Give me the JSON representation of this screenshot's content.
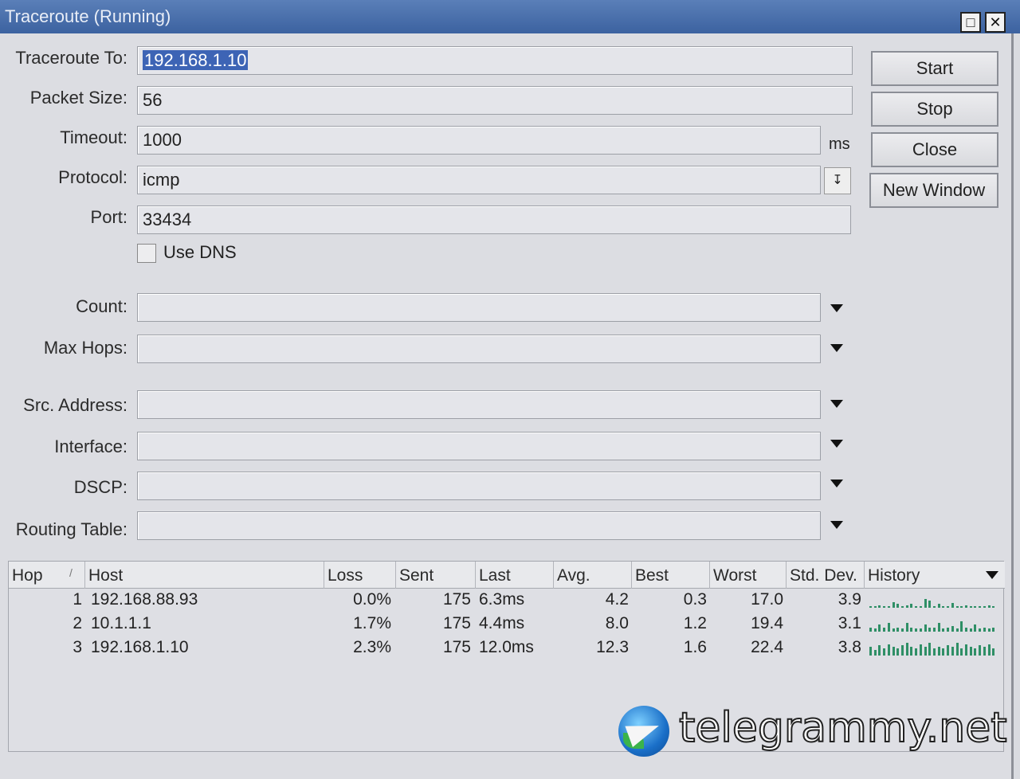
{
  "window": {
    "title": "Traceroute (Running)",
    "maximize_icon": "□",
    "close_icon": "✕"
  },
  "form": {
    "traceroute_to_label": "Traceroute To:",
    "traceroute_to_value": "192.168.1.10",
    "packet_size_label": "Packet Size:",
    "packet_size_value": "56",
    "timeout_label": "Timeout:",
    "timeout_value": "1000",
    "timeout_unit": "ms",
    "protocol_label": "Protocol:",
    "protocol_value": "icmp",
    "port_label": "Port:",
    "port_value": "33434",
    "use_dns_label": "Use DNS",
    "use_dns_checked": false,
    "count_label": "Count:",
    "max_hops_label": "Max Hops:",
    "src_address_label": "Src. Address:",
    "interface_label": "Interface:",
    "dscp_label": "DSCP:",
    "routing_table_label": "Routing Table:"
  },
  "buttons": {
    "start": "Start",
    "stop": "Stop",
    "close": "Close",
    "new_window": "New Window"
  },
  "table": {
    "headers": [
      "Hop",
      "Host",
      "Loss",
      "Sent",
      "Last",
      "Avg.",
      "Best",
      "Worst",
      "Std. Dev.",
      "History"
    ],
    "sort_indicator": "/",
    "rows": [
      {
        "hop": "1",
        "host": "192.168.88.93",
        "loss": "0.0%",
        "sent": "175",
        "last": "6.3ms",
        "avg": "4.2",
        "best": "0.3",
        "worst": "17.0",
        "std_dev": "3.9",
        "history": [
          0.1,
          0.1,
          0.15,
          0.1,
          0.1,
          0.4,
          0.3,
          0.1,
          0.15,
          0.3,
          0.1,
          0.1,
          0.6,
          0.5,
          0.1,
          0.3,
          0.1,
          0.1,
          0.35,
          0.1,
          0.1,
          0.15,
          0.1,
          0.1,
          0.1,
          0.1,
          0.15,
          0.1
        ]
      },
      {
        "hop": "2",
        "host": "10.1.1.1",
        "loss": "1.7%",
        "sent": "175",
        "last": "4.4ms",
        "avg": "8.0",
        "best": "1.2",
        "worst": "19.4",
        "std_dev": "3.1",
        "history": [
          0.3,
          0.2,
          0.5,
          0.3,
          0.6,
          0.2,
          0.3,
          0.2,
          0.6,
          0.3,
          0.2,
          0.2,
          0.5,
          0.3,
          0.3,
          0.6,
          0.2,
          0.3,
          0.4,
          0.2,
          0.7,
          0.3,
          0.2,
          0.5,
          0.2,
          0.3,
          0.2,
          0.3
        ]
      },
      {
        "hop": "3",
        "host": "192.168.1.10",
        "loss": "2.3%",
        "sent": "175",
        "last": "12.0ms",
        "avg": "12.3",
        "best": "1.6",
        "worst": "22.4",
        "std_dev": "3.8",
        "history": [
          0.6,
          0.4,
          0.7,
          0.5,
          0.8,
          0.6,
          0.5,
          0.7,
          0.9,
          0.6,
          0.5,
          0.8,
          0.6,
          0.9,
          0.5,
          0.6,
          0.5,
          0.7,
          0.6,
          0.9,
          0.5,
          0.8,
          0.6,
          0.5,
          0.7,
          0.6,
          0.8,
          0.5
        ]
      }
    ],
    "colors": {
      "history_bar": "#2f8f66"
    }
  },
  "watermark": {
    "text": "telegrammy.net",
    "logo": "telegram-plane-globe-icon"
  }
}
